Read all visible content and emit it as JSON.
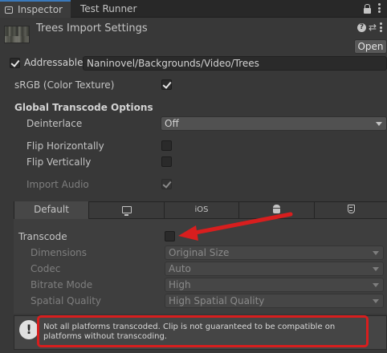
{
  "tabs": {
    "inspector": "Inspector",
    "test_runner": "Test Runner"
  },
  "header": {
    "title": "Trees Import Settings",
    "open_button": "Open"
  },
  "addressable": {
    "label": "Addressable",
    "checked": true,
    "address": "Naninovel/Backgrounds/Video/Trees"
  },
  "settings": {
    "srgb_label": "sRGB (Color Texture)",
    "srgb_checked": true,
    "transcode_heading": "Global Transcode Options",
    "deinterlace_label": "Deinterlace",
    "deinterlace_value": "Off",
    "flip_horizontally_label": "Flip Horizontally",
    "flip_vertically_label": "Flip Vertically",
    "import_audio_label": "Import Audio"
  },
  "platform_tabs": {
    "default": "Default",
    "ios": "iOS",
    "icons": [
      "monitor-icon",
      "android-icon",
      "html5-icon"
    ]
  },
  "platform_panel": {
    "transcode_label": "Transcode",
    "transcode_checked": false,
    "dimensions_label": "Dimensions",
    "dimensions_value": "Original Size",
    "codec_label": "Codec",
    "codec_value": "Auto",
    "bitrate_label": "Bitrate Mode",
    "bitrate_value": "High",
    "spatial_label": "Spatial Quality",
    "spatial_value": "High Spatial Quality"
  },
  "warning": {
    "icon": "!",
    "text": "Not all platforms transcoded. Clip is not guaranteed to be compatible on platforms without transcoding."
  },
  "colors": {
    "annotation_red": "#d81e1e",
    "tab_accent": "#3a79bb"
  }
}
